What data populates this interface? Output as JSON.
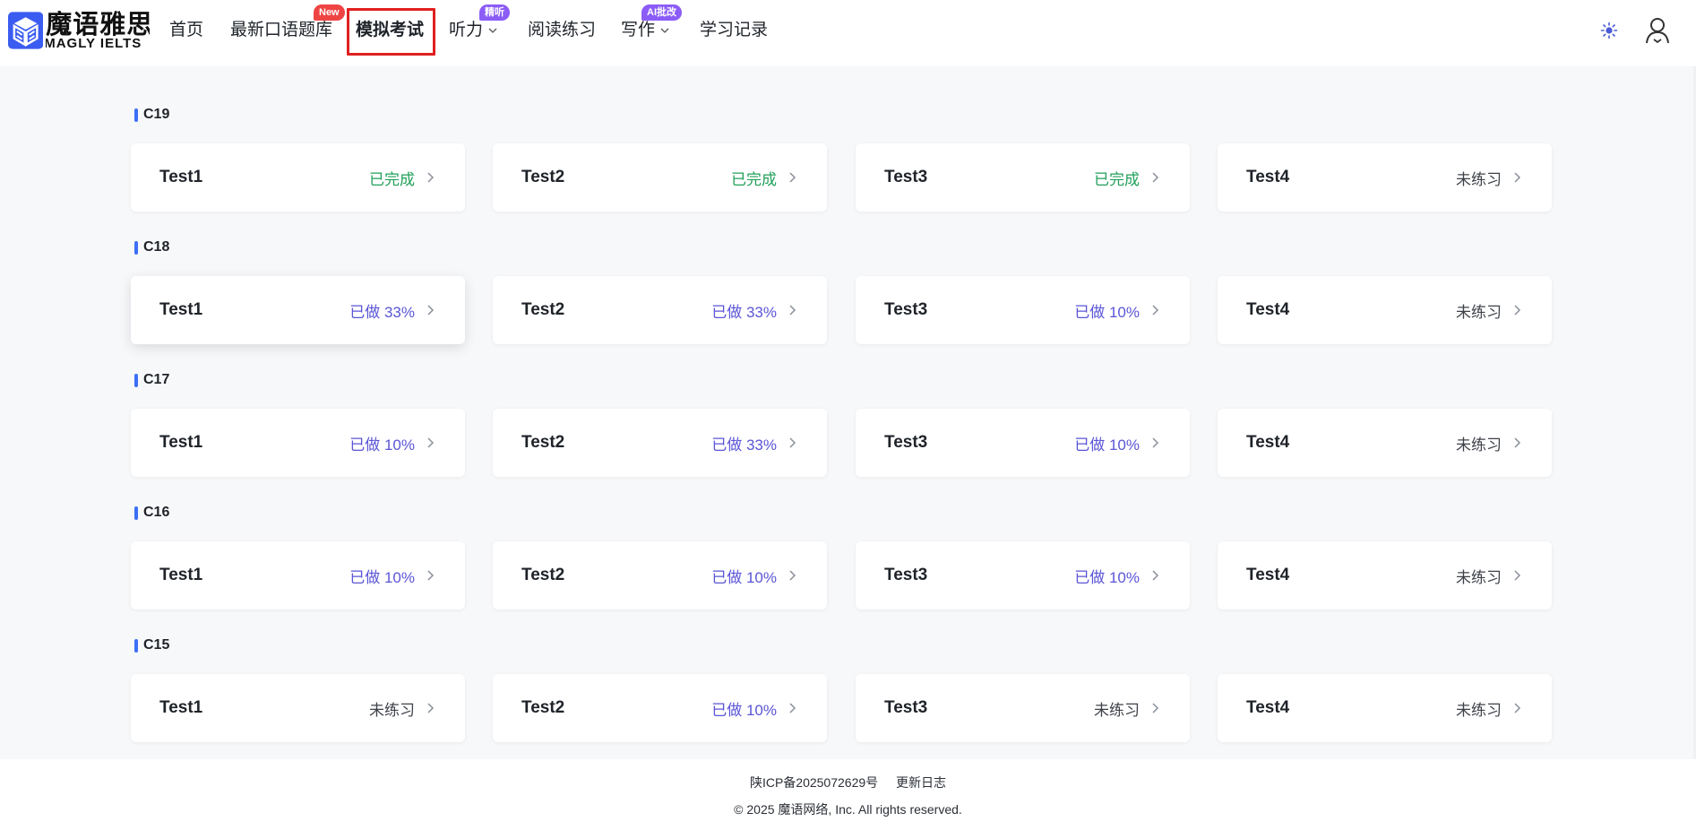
{
  "brand": {
    "name_cn": "魔语雅思",
    "name_en": "MAGLY IELTS"
  },
  "nav": {
    "items": [
      {
        "label": "首页"
      },
      {
        "label": "最新口语题库",
        "badge": "New"
      },
      {
        "label": "模拟考试",
        "active": true
      },
      {
        "label": "听力",
        "badge": "精听",
        "dropdown": true
      },
      {
        "label": "阅读练习"
      },
      {
        "label": "写作",
        "badge": "AI批改",
        "dropdown": true
      },
      {
        "label": "学习记录"
      }
    ]
  },
  "header_icons": [
    "sun-icon",
    "user-icon"
  ],
  "sections": [
    {
      "title": "C19",
      "tests": [
        {
          "name": "Test1",
          "status": "已完成",
          "state": "done"
        },
        {
          "name": "Test2",
          "status": "已完成",
          "state": "done"
        },
        {
          "name": "Test3",
          "status": "已完成",
          "state": "done"
        },
        {
          "name": "Test4",
          "status": "未练习",
          "state": "none"
        }
      ]
    },
    {
      "title": "C18",
      "tests": [
        {
          "name": "Test1",
          "status": "已做 33%",
          "state": "progress"
        },
        {
          "name": "Test2",
          "status": "已做 33%",
          "state": "progress"
        },
        {
          "name": "Test3",
          "status": "已做 10%",
          "state": "progress"
        },
        {
          "name": "Test4",
          "status": "未练习",
          "state": "none"
        }
      ]
    },
    {
      "title": "C17",
      "tests": [
        {
          "name": "Test1",
          "status": "已做 10%",
          "state": "progress"
        },
        {
          "name": "Test2",
          "status": "已做 33%",
          "state": "progress"
        },
        {
          "name": "Test3",
          "status": "已做 10%",
          "state": "progress"
        },
        {
          "name": "Test4",
          "status": "未练习",
          "state": "none"
        }
      ]
    },
    {
      "title": "C16",
      "tests": [
        {
          "name": "Test1",
          "status": "已做 10%",
          "state": "progress"
        },
        {
          "name": "Test2",
          "status": "已做 10%",
          "state": "progress"
        },
        {
          "name": "Test3",
          "status": "已做 10%",
          "state": "progress"
        },
        {
          "name": "Test4",
          "status": "未练习",
          "state": "none"
        }
      ]
    },
    {
      "title": "C15",
      "tests": [
        {
          "name": "Test1",
          "status": "未练习",
          "state": "none"
        },
        {
          "name": "Test2",
          "status": "已做 10%",
          "state": "progress"
        },
        {
          "name": "Test3",
          "status": "未练习",
          "state": "none"
        },
        {
          "name": "Test4",
          "status": "未练习",
          "state": "none"
        }
      ]
    }
  ],
  "colors": {
    "done": "#22a05a",
    "progress": "#5a55d6",
    "none": "#3d4148",
    "accent": "#3b6ff5",
    "active_outline": "#e02020"
  },
  "footer": {
    "icp": "陕ICP备2025072629号",
    "changelog": "更新日志",
    "copyright": "© 2025 魔语网络, Inc. All rights reserved."
  }
}
